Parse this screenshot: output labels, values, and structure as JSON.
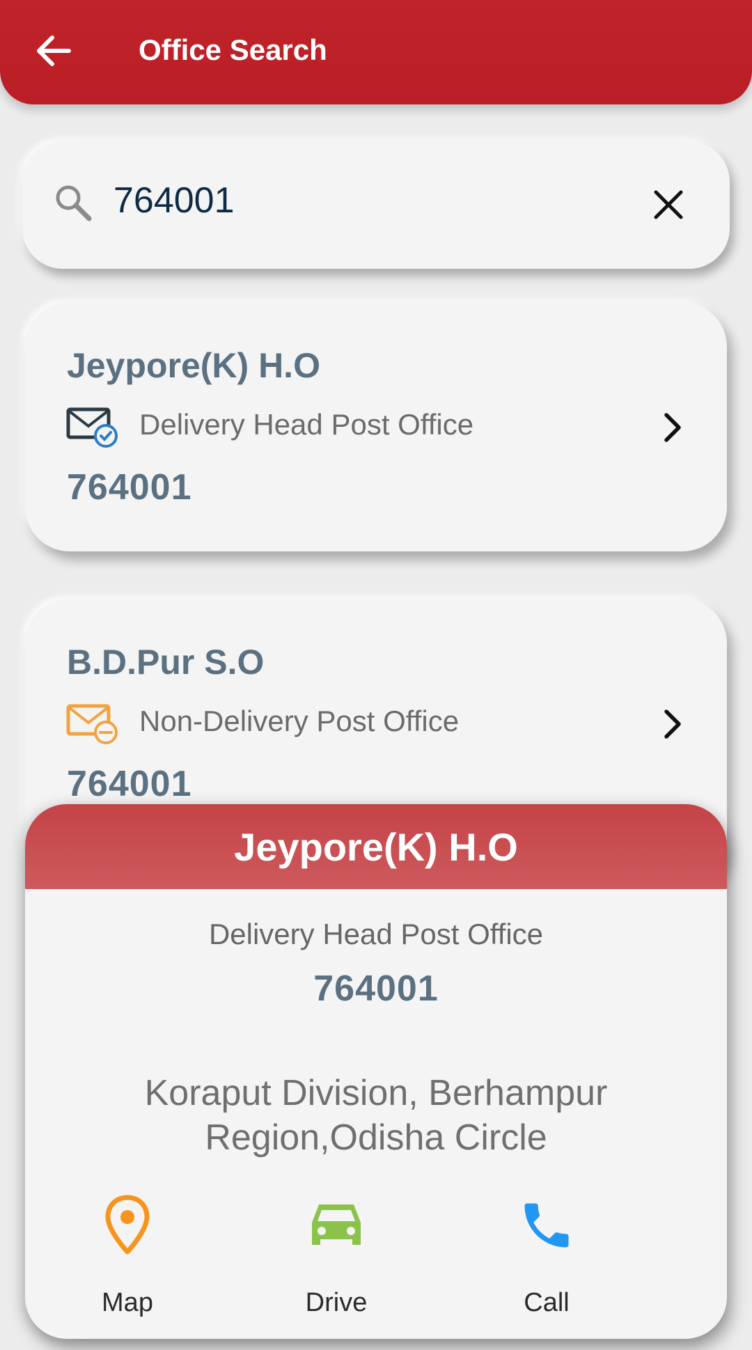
{
  "app_bar": {
    "title": "Office Search",
    "back_icon": "arrow-left-icon",
    "background": "#bf2228"
  },
  "search": {
    "value": "764001",
    "search_icon": "search-icon",
    "clear_icon": "close-icon"
  },
  "results": [
    {
      "name": "Jeypore(K) H.O",
      "type": "Delivery Head Post Office",
      "type_icon": "mail-check-icon",
      "pincode": "764001"
    },
    {
      "name": "B.D.Pur S.O",
      "type": "Non-Delivery Post Office",
      "type_icon": "mail-minus-icon",
      "pincode": "764001"
    }
  ],
  "detail": {
    "title": "Jeypore(K) H.O",
    "type": "Delivery Head Post Office",
    "pincode": "764001",
    "address": "Koraput Division, Berhampur Region,Odisha Circle",
    "header_color": "#c8494c",
    "actions": [
      {
        "label": "Map",
        "icon": "map-pin-icon",
        "color": "#f7941d"
      },
      {
        "label": "Drive",
        "icon": "car-icon",
        "color": "#8bc34a"
      },
      {
        "label": "Call",
        "icon": "phone-icon",
        "color": "#2196f3"
      }
    ]
  }
}
